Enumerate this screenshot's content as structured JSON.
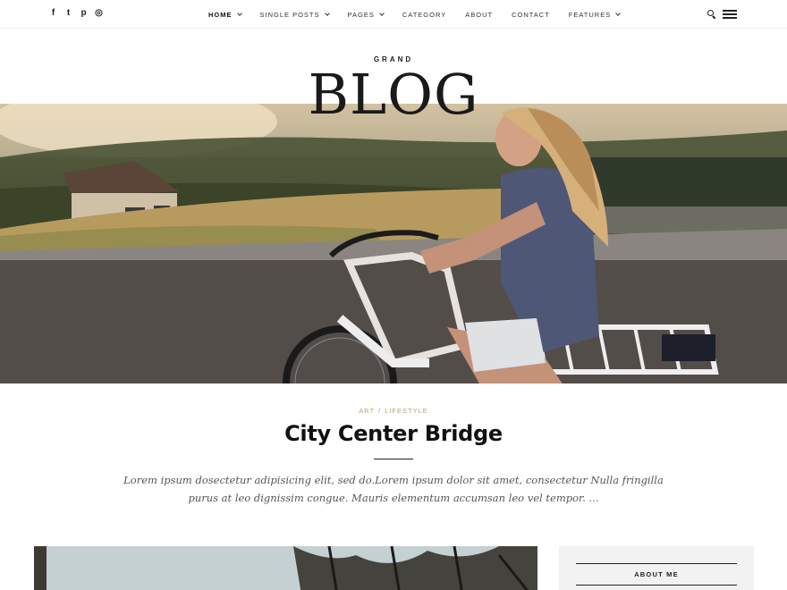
{
  "social": {
    "icons": [
      "facebook-icon",
      "twitter-icon",
      "pinterest-icon",
      "instagram-icon"
    ],
    "glyphs": [
      "f",
      "t",
      "p",
      "◎"
    ]
  },
  "nav": {
    "items": [
      {
        "label": "HOME",
        "has_dropdown": true,
        "active": true
      },
      {
        "label": "SINGLE POSTS",
        "has_dropdown": true,
        "active": false
      },
      {
        "label": "PAGES",
        "has_dropdown": true,
        "active": false
      },
      {
        "label": "CATEGORY",
        "has_dropdown": false,
        "active": false
      },
      {
        "label": "ABOUT",
        "has_dropdown": false,
        "active": false
      },
      {
        "label": "CONTACT",
        "has_dropdown": false,
        "active": false
      },
      {
        "label": "FEATURES",
        "has_dropdown": true,
        "active": false
      }
    ]
  },
  "logo": {
    "top": "GRAND",
    "main": "BLOG"
  },
  "post": {
    "categories": [
      "ART",
      "LIFESTYLE"
    ],
    "separator": "/",
    "title": "City Center Bridge",
    "excerpt": "Lorem ipsum dosectetur adipisicing elit, sed do.Lorem ipsum dolor sit amet, consectetur Nulla fringilla purus at leo dignissim congue. Mauris elementum accumsan leo vel tempor. ..."
  },
  "sidebar": {
    "widget_title": "ABOUT ME"
  },
  "colors": {
    "accent": "#c29b6a",
    "text": "#222222",
    "sidebar_bg": "#f2f2f2"
  }
}
